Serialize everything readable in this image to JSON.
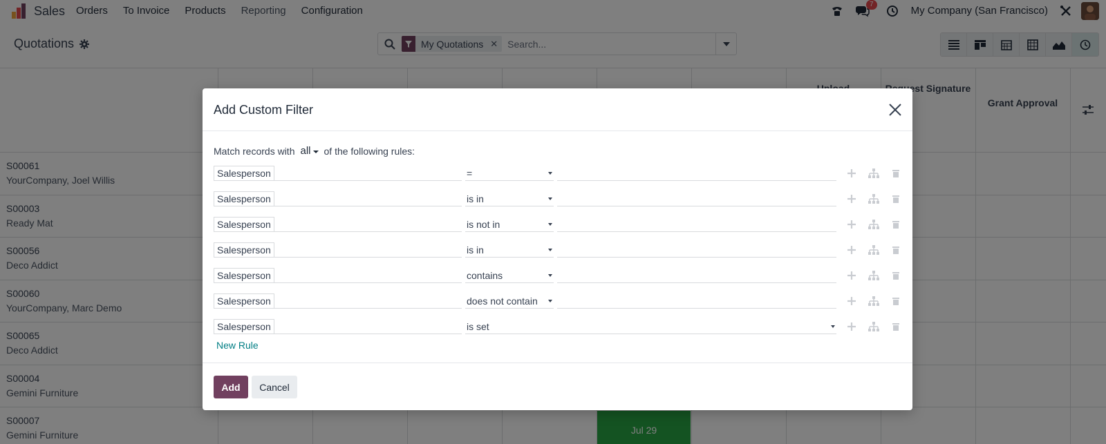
{
  "navbar": {
    "app_name": "Sales",
    "menu": [
      "Orders",
      "To Invoice",
      "Products",
      "Reporting",
      "Configuration"
    ],
    "messages_badge": "7",
    "company": "My Company (San Francisco)"
  },
  "control_panel": {
    "breadcrumb": "Quotations",
    "search": {
      "facet_label": "My Quotations",
      "placeholder": "Search..."
    }
  },
  "grid": {
    "column_headers": [
      "Upload",
      "Request Signature",
      "Grant Approval"
    ],
    "rows": [
      {
        "ref": "S00061",
        "partner": "YourCompany, Joel Willis"
      },
      {
        "ref": "S00003",
        "partner": "Ready Mat"
      },
      {
        "ref": "S00056",
        "partner": "Deco Addict"
      },
      {
        "ref": "S00060",
        "partner": "YourCompany, Marc Demo"
      },
      {
        "ref": "S00065",
        "partner": "Deco Addict"
      },
      {
        "ref": "S00004",
        "partner": "Gemini Furniture"
      },
      {
        "ref": "S00007",
        "partner": "Gemini Furniture"
      }
    ],
    "green_cell_label": "Jul 29"
  },
  "modal": {
    "title": "Add Custom Filter",
    "match_prefix": "Match records with",
    "match_value": "all",
    "match_suffix": "of the following rules:",
    "rules": [
      {
        "field": "Salesperson",
        "operator": "="
      },
      {
        "field": "Salesperson",
        "operator": "is in"
      },
      {
        "field": "Salesperson",
        "operator": "is not in"
      },
      {
        "field": "Salesperson",
        "operator": "is in"
      },
      {
        "field": "Salesperson",
        "operator": "contains"
      },
      {
        "field": "Salesperson",
        "operator": "does not contain"
      },
      {
        "field": "Salesperson",
        "operator": "is set"
      }
    ],
    "new_rule_label": "New Rule",
    "add_label": "Add",
    "cancel_label": "Cancel"
  },
  "colors": {
    "brand": "#71405f",
    "link": "#017e84",
    "success": "#28a745"
  }
}
